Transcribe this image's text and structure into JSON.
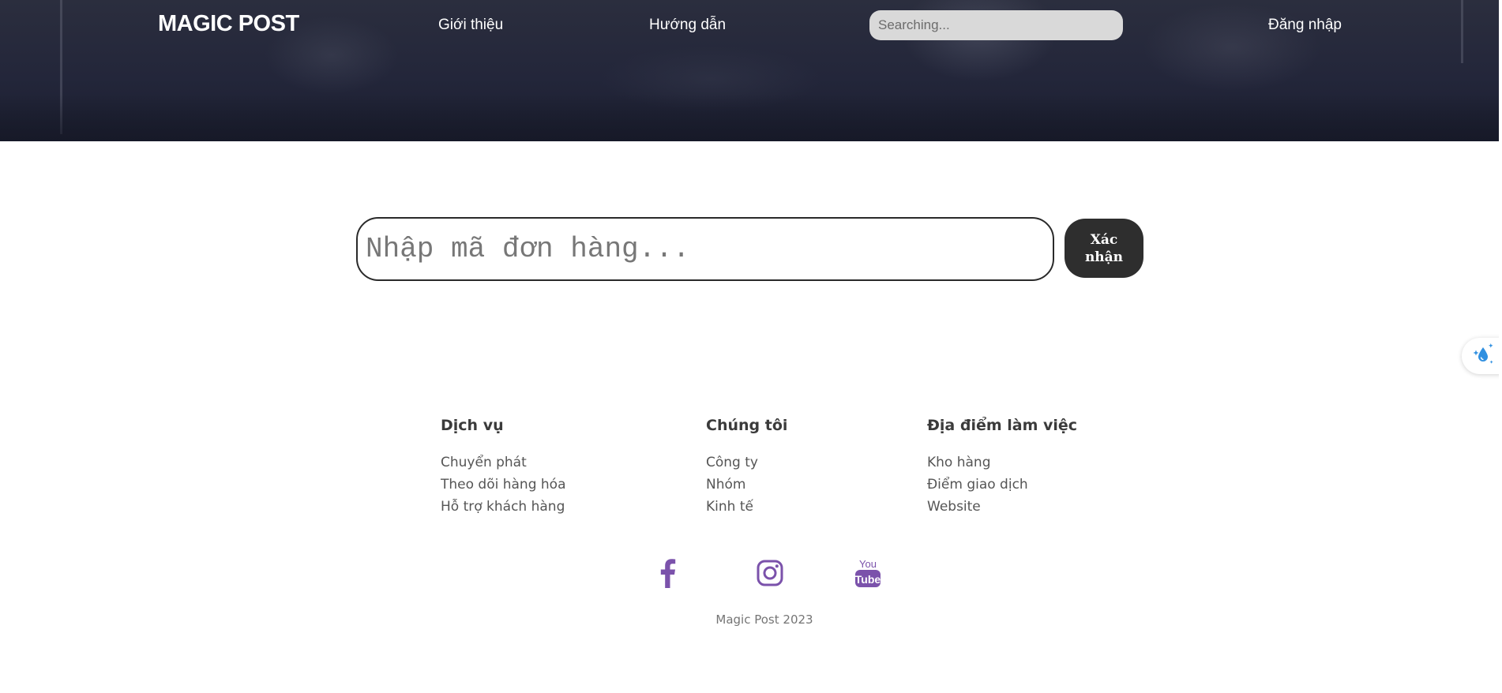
{
  "header": {
    "brand": "MAGIC POST",
    "nav": {
      "intro": "Giới thiệu",
      "guide": "Hướng dẫn",
      "login": "Đăng nhập"
    },
    "search": {
      "placeholder": "Searching...",
      "value": ""
    }
  },
  "order_lookup": {
    "placeholder": "Nhập mã đơn hàng...",
    "value": "",
    "confirm_label": "Xác nhận"
  },
  "footer": {
    "columns": [
      {
        "heading": "Dịch vụ",
        "items": [
          "Chuyển phát",
          "Theo dõi hàng hóa",
          "Hỗ trợ khách hàng"
        ]
      },
      {
        "heading": "Chúng tôi",
        "items": [
          "Công ty",
          "Nhóm",
          "Kinh tế"
        ]
      },
      {
        "heading": "Địa điểm làm việc",
        "items": [
          "Kho hàng",
          "Điểm giao dịch",
          "Website"
        ]
      }
    ],
    "social": [
      {
        "name": "facebook-icon"
      },
      {
        "name": "instagram-icon"
      },
      {
        "name": "youtube-icon",
        "text_top": "You",
        "text_bottom": "Tube"
      }
    ],
    "copyright": "Magic Post 2023"
  },
  "side_widget": {
    "icon": "sparkle-drop-icon"
  },
  "colors": {
    "header_bg": "#23263a",
    "social": "#7b52ab",
    "button_bg": "#2e2e2e",
    "widget_accent": "#2f8fe0"
  }
}
